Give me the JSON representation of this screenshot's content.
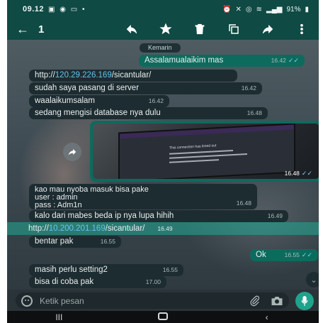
{
  "status_bar": {
    "time": "09.12",
    "left_icons": [
      "photo-icon",
      "whatsapp-icon",
      "mail-icon",
      "dot"
    ],
    "right_icons": [
      "alarm-icon",
      "mute-icon",
      "hotspot-icon",
      "wifi-icon",
      "signal-icon"
    ],
    "battery": "91%"
  },
  "action_bar": {
    "selected_count": "1",
    "actions": [
      "reply-icon",
      "star-icon",
      "delete-icon",
      "copy-icon",
      "forward-icon",
      "more-icon"
    ]
  },
  "date_chip": "Kemarin",
  "messages": [
    {
      "dir": "out",
      "text": "Assalamualaikim mas",
      "time": "16.42",
      "read": true
    },
    {
      "dir": "in",
      "prefix": "http://",
      "link": "120.29.226.169",
      "suffix": "/sicantular/",
      "time": ""
    },
    {
      "dir": "in",
      "text": "sudah saya pasang di server",
      "time": "16.42"
    },
    {
      "dir": "in",
      "text": "waalaikumsalam",
      "time": "16.42"
    },
    {
      "dir": "in",
      "text": "sedang mengisi database nya dulu",
      "time": "16.48"
    },
    {
      "dir": "in",
      "lines": [
        "kao mau nyoba masuk bisa pake",
        "user : admin",
        "pass : Adm1n"
      ],
      "time": "16.48"
    },
    {
      "dir": "in",
      "text": "kalo dari mabes beda ip nya lupa hihih",
      "time": "16.49"
    },
    {
      "dir": "in",
      "prefix": "http://",
      "link": "10.200.201.169",
      "suffix": "/sicantular/",
      "time": "16.49",
      "selected": true
    },
    {
      "dir": "in",
      "text": "bentar pak",
      "time": "16.55"
    },
    {
      "dir": "out",
      "text": "Ok",
      "time": "16.55",
      "read": true
    },
    {
      "dir": "in",
      "text": "masih perlu setting2",
      "time": "16.55"
    },
    {
      "dir": "in",
      "text": "bisa di coba pak",
      "time": "17.00"
    }
  ],
  "image_message": {
    "time": "16.48",
    "read": true,
    "caption_heading": "This connection has timed out"
  },
  "input": {
    "placeholder": "Ketik pesan"
  },
  "colors": {
    "header": "#0f4a44",
    "outgoing_bubble": "#0c6b5d",
    "incoming_bubble": "#1d2c31",
    "link": "#64c4e8",
    "read_ticks": "#7fd3f3",
    "mic_button": "#1fa38c"
  }
}
